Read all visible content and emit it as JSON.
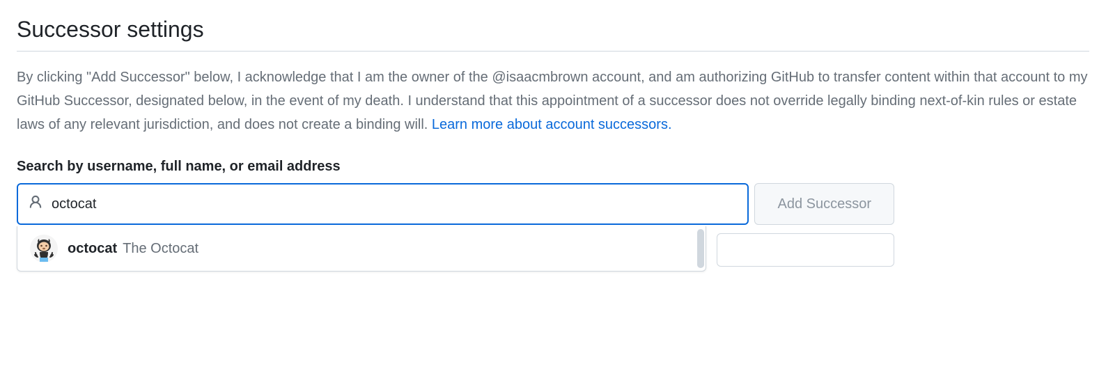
{
  "page": {
    "title": "Successor settings"
  },
  "description": {
    "text": "By clicking \"Add Successor\" below, I acknowledge that I am the owner of the @isaacmbrown account, and am authorizing GitHub to transfer content within that account to my GitHub Successor, designated below, in the event of my death. I understand that this appointment of a successor does not override legally binding next-of-kin rules or estate laws of any relevant jurisdiction, and does not create a binding will. ",
    "link_text": "Learn more about account successors."
  },
  "search": {
    "label": "Search by username, full name, or email address",
    "value": "octocat",
    "button_label": "Add Successor"
  },
  "results": [
    {
      "username": "octocat",
      "fullname": "The Octocat"
    }
  ]
}
